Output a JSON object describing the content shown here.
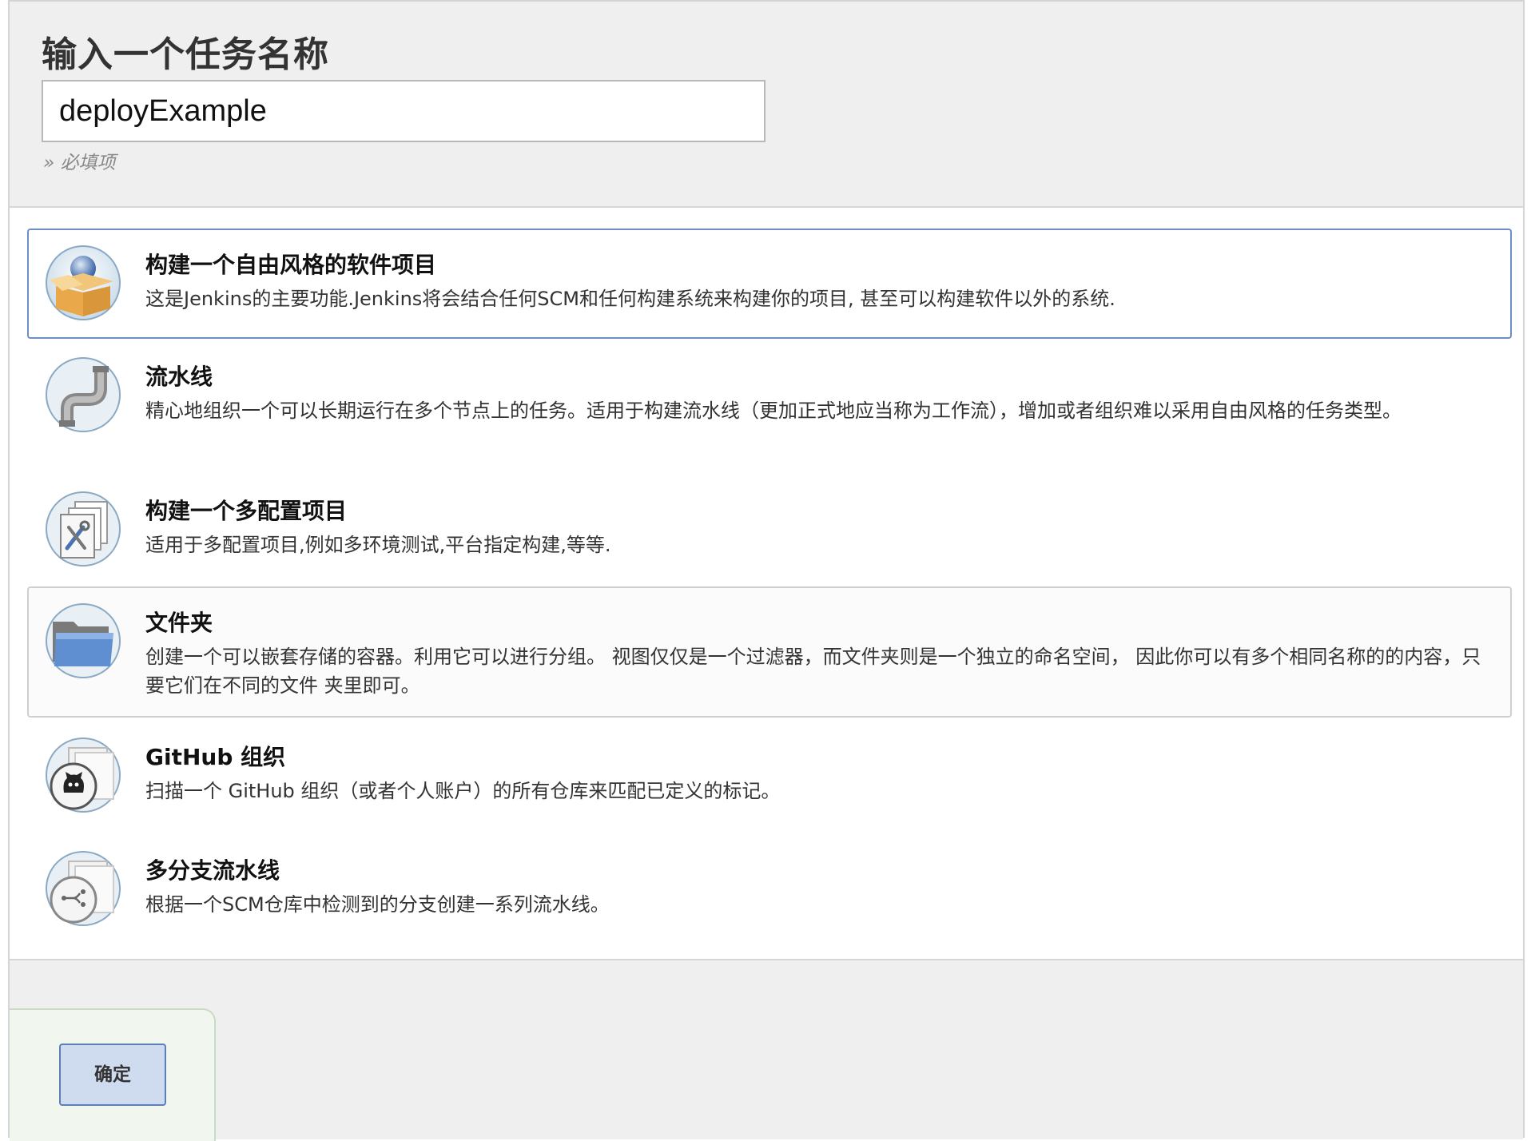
{
  "header": {
    "title": "输入一个任务名称",
    "item_name_value": "deployExample",
    "required_hint": "» 必填项"
  },
  "items": [
    {
      "title": "构建一个自由风格的软件项目",
      "description": "这是Jenkins的主要功能.Jenkins将会结合任何SCM和任何构建系统来构建你的项目, 甚至可以构建软件以外的系统.",
      "icon": "freestyle-project-icon",
      "state": "selected"
    },
    {
      "title": "流水线",
      "description": "精心地组织一个可以长期运行在多个节点上的任务。适用于构建流水线（更加正式地应当称为工作流），增加或者组织难以采用自由风格的任务类型。",
      "icon": "pipeline-icon",
      "state": "normal"
    },
    {
      "title": "构建一个多配置项目",
      "description": "适用于多配置项目,例如多环境测试,平台指定构建,等等.",
      "icon": "multi-config-project-icon",
      "state": "normal"
    },
    {
      "title": "文件夹",
      "description": "创建一个可以嵌套存储的容器。利用它可以进行分组。 视图仅仅是一个过滤器，而文件夹则是一个独立的命名空间， 因此你可以有多个相同名称的的内容，只要它们在不同的文件 夹里即可。",
      "icon": "folder-icon",
      "state": "hover"
    },
    {
      "title": "GitHub 组织",
      "description": "扫描一个 GitHub 组织（或者个人账户）的所有仓库来匹配已定义的标记。",
      "icon": "github-organization-icon",
      "state": "normal"
    },
    {
      "title": "多分支流水线",
      "description": "根据一个SCM仓库中检测到的分支创建一系列流水线。",
      "icon": "multibranch-pipeline-icon",
      "state": "normal"
    }
  ],
  "footer": {
    "ok_label": "确定"
  },
  "colors": {
    "selected_border": "#6f8fc4",
    "ok_button_bg": "#cfdcef",
    "ok_panel_bg": "#f1f6ef"
  }
}
